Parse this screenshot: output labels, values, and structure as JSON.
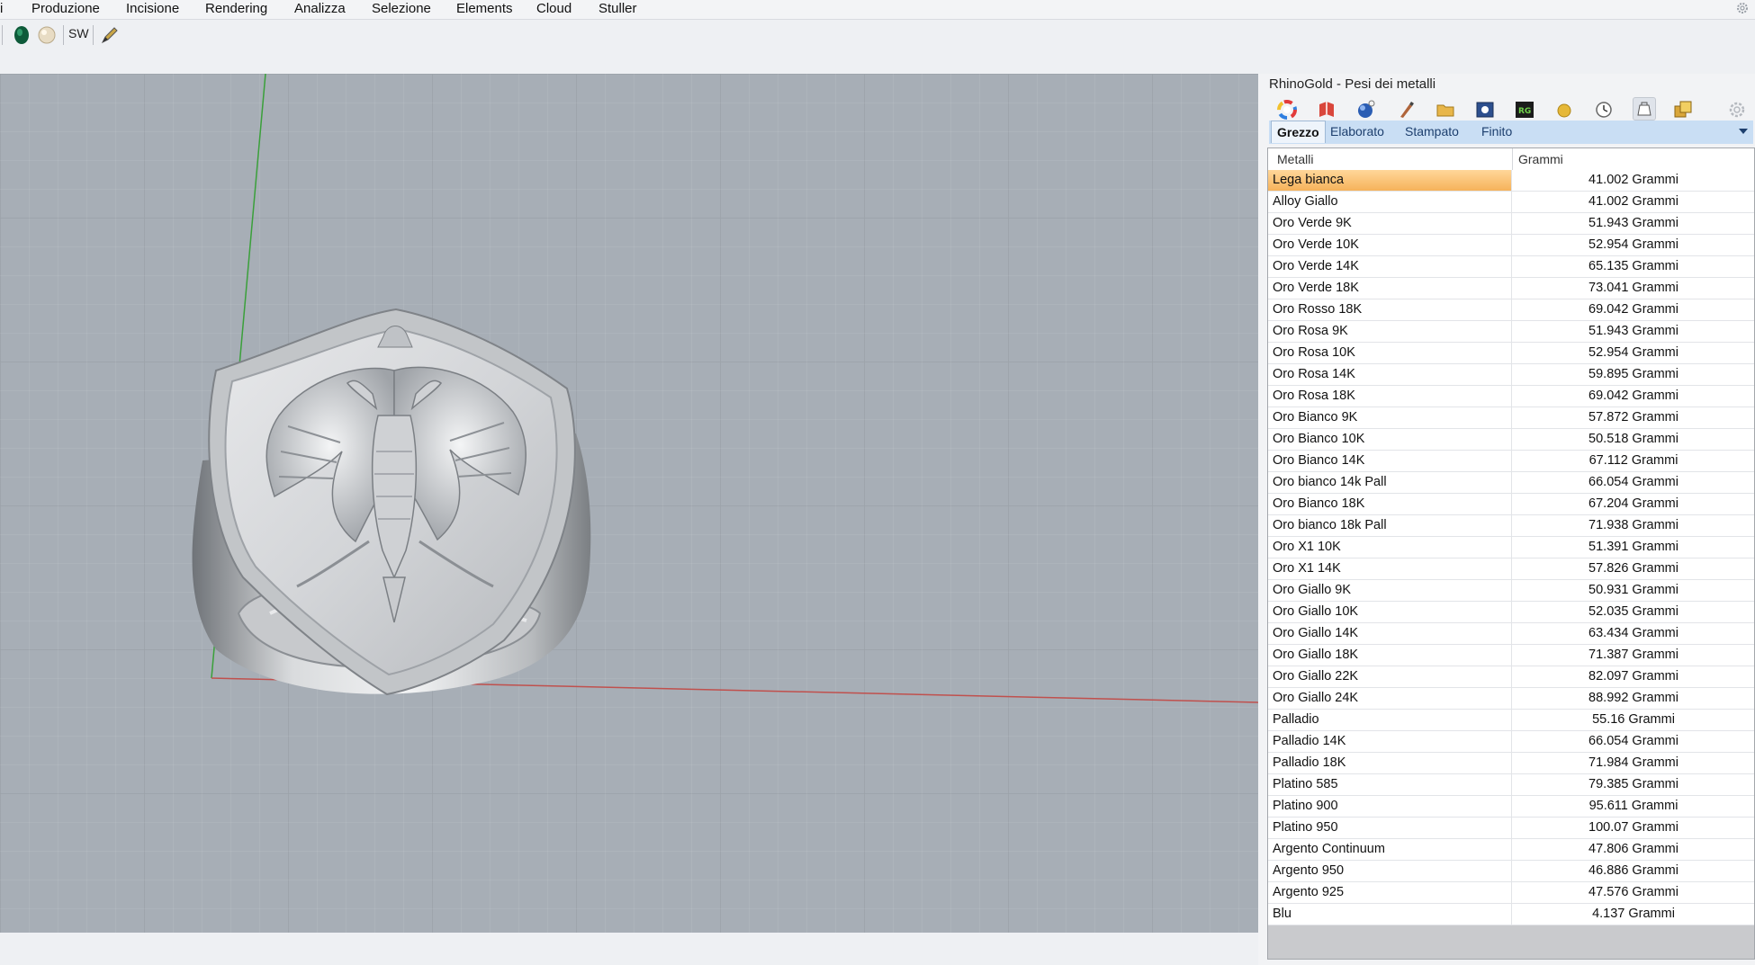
{
  "menu": {
    "items": [
      "i",
      "Produzione",
      "Incisione",
      "Rendering",
      "Analizza",
      "Selezione",
      "Elements",
      "Cloud",
      "Stuller"
    ]
  },
  "toolbar": {
    "sw_label": "SW",
    "icons": [
      "gem-icon",
      "pearl-icon",
      "pencil-icon"
    ]
  },
  "panel": {
    "title": "RhinoGold - Pesi dei metalli",
    "icons": [
      "color-wheel-icon",
      "book-icon",
      "gem-settings-icon",
      "brush-icon",
      "folder-icon",
      "image-icon",
      "rg-logo-icon",
      "gold-coin-icon",
      "clock-icon",
      "weight-icon",
      "metals-icon"
    ],
    "tabs": [
      "Grezzo",
      "Elaborato",
      "Stampato",
      "Finito"
    ],
    "active_tab": "Grezzo",
    "table": {
      "col_metal": "Metalli",
      "col_grams": "Grammi",
      "selected_index": 0,
      "rows": [
        {
          "metal": "Lega bianca",
          "grams": "41.002 Grammi"
        },
        {
          "metal": "Alloy Giallo",
          "grams": "41.002 Grammi"
        },
        {
          "metal": "Oro Verde 9K",
          "grams": "51.943 Grammi"
        },
        {
          "metal": "Oro Verde 10K",
          "grams": "52.954 Grammi"
        },
        {
          "metal": "Oro Verde 14K",
          "grams": "65.135 Grammi"
        },
        {
          "metal": "Oro Verde 18K",
          "grams": "73.041 Grammi"
        },
        {
          "metal": "Oro Rosso 18K",
          "grams": "69.042 Grammi"
        },
        {
          "metal": "Oro Rosa 9K",
          "grams": "51.943 Grammi"
        },
        {
          "metal": "Oro Rosa 10K",
          "grams": "52.954 Grammi"
        },
        {
          "metal": "Oro Rosa 14K",
          "grams": "59.895 Grammi"
        },
        {
          "metal": "Oro Rosa 18K",
          "grams": "69.042 Grammi"
        },
        {
          "metal": "Oro Bianco 9K",
          "grams": "57.872 Grammi"
        },
        {
          "metal": "Oro Bianco 10K",
          "grams": "50.518 Grammi"
        },
        {
          "metal": "Oro Bianco 14K",
          "grams": "67.112 Grammi"
        },
        {
          "metal": "Oro bianco 14k Pall",
          "grams": "66.054 Grammi"
        },
        {
          "metal": "Oro Bianco 18K",
          "grams": "67.204 Grammi"
        },
        {
          "metal": "Oro bianco 18k Pall",
          "grams": "71.938 Grammi"
        },
        {
          "metal": "Oro X1 10K",
          "grams": "51.391 Grammi"
        },
        {
          "metal": "Oro X1 14K",
          "grams": "57.826 Grammi"
        },
        {
          "metal": "Oro Giallo 9K",
          "grams": "50.931 Grammi"
        },
        {
          "metal": "Oro Giallo 10K",
          "grams": "52.035 Grammi"
        },
        {
          "metal": "Oro Giallo 14K",
          "grams": "63.434 Grammi"
        },
        {
          "metal": "Oro Giallo 18K",
          "grams": "71.387 Grammi"
        },
        {
          "metal": "Oro Giallo 22K",
          "grams": "82.097 Grammi"
        },
        {
          "metal": "Oro Giallo 24K",
          "grams": "88.992 Grammi"
        },
        {
          "metal": "Palladio",
          "grams": "55.16 Grammi"
        },
        {
          "metal": "Palladio 14K",
          "grams": "66.054 Grammi"
        },
        {
          "metal": "Palladio 18K",
          "grams": "71.984 Grammi"
        },
        {
          "metal": "Platino 585",
          "grams": "79.385 Grammi"
        },
        {
          "metal": "Platino 900",
          "grams": "95.611 Grammi"
        },
        {
          "metal": "Platino 950",
          "grams": "100.07 Grammi"
        },
        {
          "metal": "Argento Continuum",
          "grams": "47.806 Grammi"
        },
        {
          "metal": "Argento 950",
          "grams": "46.886 Grammi"
        },
        {
          "metal": "Argento 925",
          "grams": "47.576 Grammi"
        },
        {
          "metal": "Blu",
          "grams": "4.137 Grammi"
        }
      ]
    }
  },
  "viewport": {
    "object": "signet-ring-eagle",
    "axis_colors": {
      "x": "#c0504d",
      "y": "#3aa03a"
    }
  }
}
